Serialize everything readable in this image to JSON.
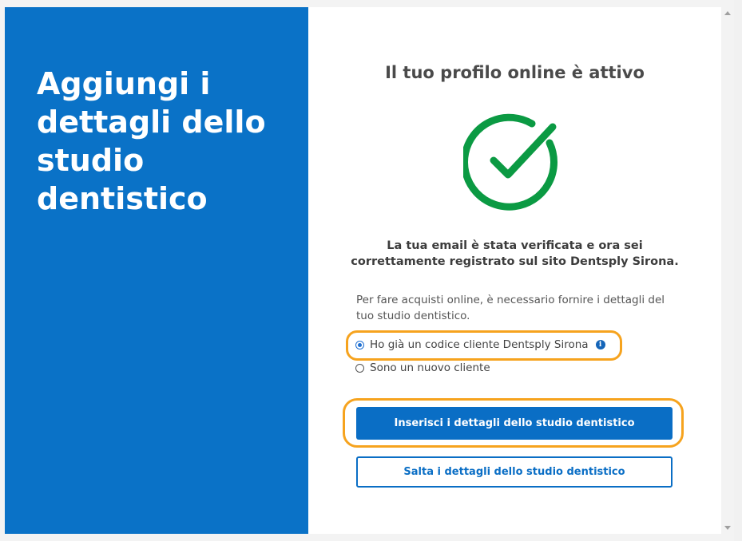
{
  "left_panel": {
    "title": "Aggiungi i dettagli dello studio dentistico",
    "background_color": "#0a72c7"
  },
  "right_panel": {
    "title": "Il tuo profilo online è attivo",
    "check_icon": "check-circle-icon",
    "check_color": "#0b9a43",
    "verified_text": "La tua email è stata verificata e ora sei correttamente registrato sul sito Dentsply Sirona.",
    "info_text": "Per fare acquisti online, è necessario fornire i dettagli del tuo studio dentistico.",
    "options": [
      {
        "label": "Ho già un codice cliente Dentsply Sirona",
        "selected": true,
        "info_icon": "info-icon"
      },
      {
        "label": "Sono un nuovo cliente",
        "selected": false
      }
    ],
    "primary_button": "Inserisci i dettagli dello studio dentistico",
    "secondary_button": "Salta i dettagli dello studio dentistico",
    "accent_color": "#0a6ec5",
    "highlight_color": "#f6a31e"
  }
}
